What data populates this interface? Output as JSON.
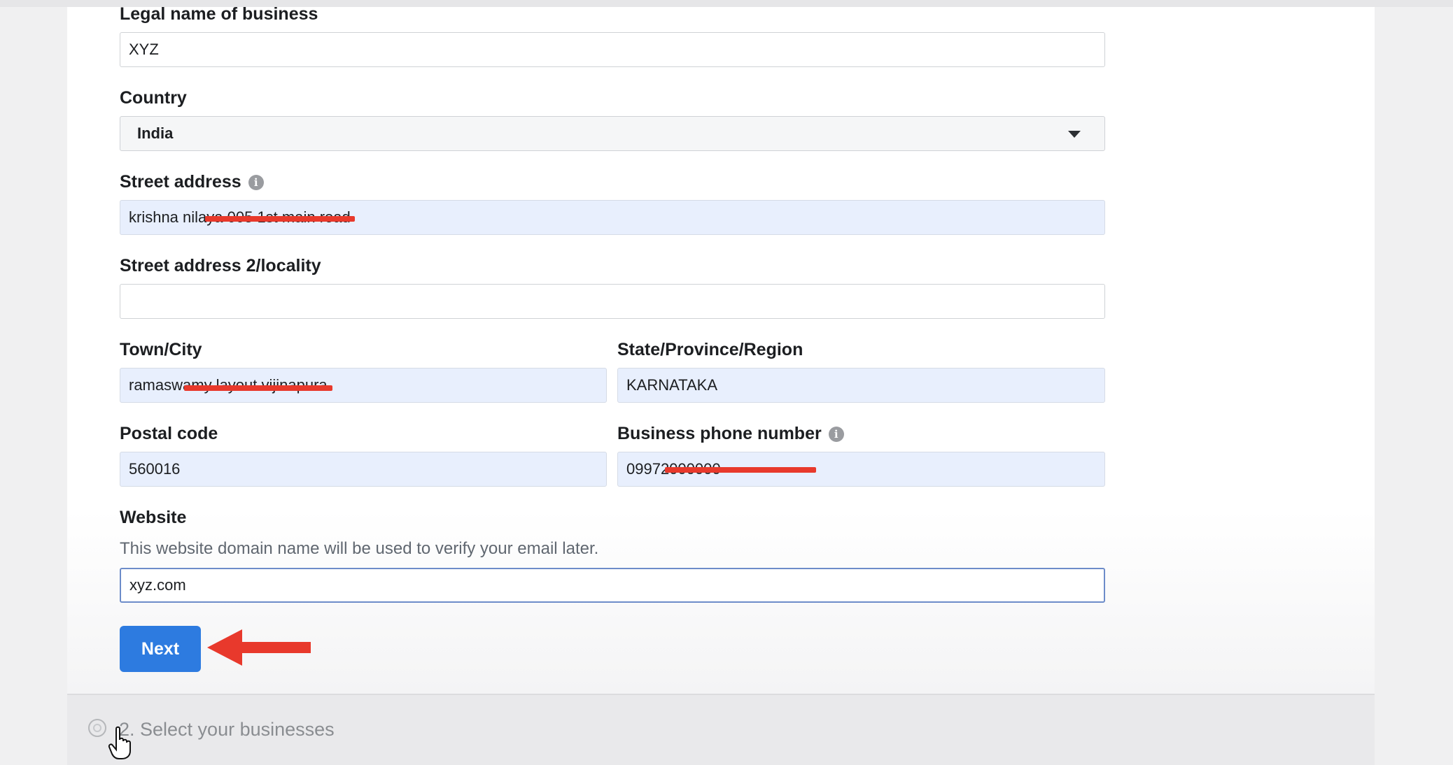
{
  "form": {
    "legal_name": {
      "label": "Legal name of business",
      "value": "XYZ"
    },
    "country": {
      "label": "Country",
      "value": "India"
    },
    "street": {
      "label": "Street address",
      "value": "krishna nilaya 005 1st main road"
    },
    "street2": {
      "label": "Street address 2/locality",
      "value": ""
    },
    "city": {
      "label": "Town/City",
      "value": "ramaswamy layout vijinapura"
    },
    "state": {
      "label": "State/Province/Region",
      "value": "KARNATAKA"
    },
    "postal": {
      "label": "Postal code",
      "value": "560016"
    },
    "phone": {
      "label": "Business phone number",
      "value": "09972000000"
    },
    "website": {
      "label": "Website",
      "help": "This website domain name will be used to verify your email later.",
      "value": "xyz.com"
    },
    "next_label": "Next"
  },
  "steps": {
    "step2": "2. Select your businesses"
  },
  "icons": {
    "info": "info-icon",
    "dropdown": "chevron-down-icon",
    "annotation": "red-arrow-left-icon",
    "cursor": "hand-pointer-icon",
    "step": "step-circle-icon"
  },
  "colors": {
    "primary_button": "#2d7be0",
    "filled_field": "#e8effd",
    "annotation_red": "#e8392c"
  }
}
